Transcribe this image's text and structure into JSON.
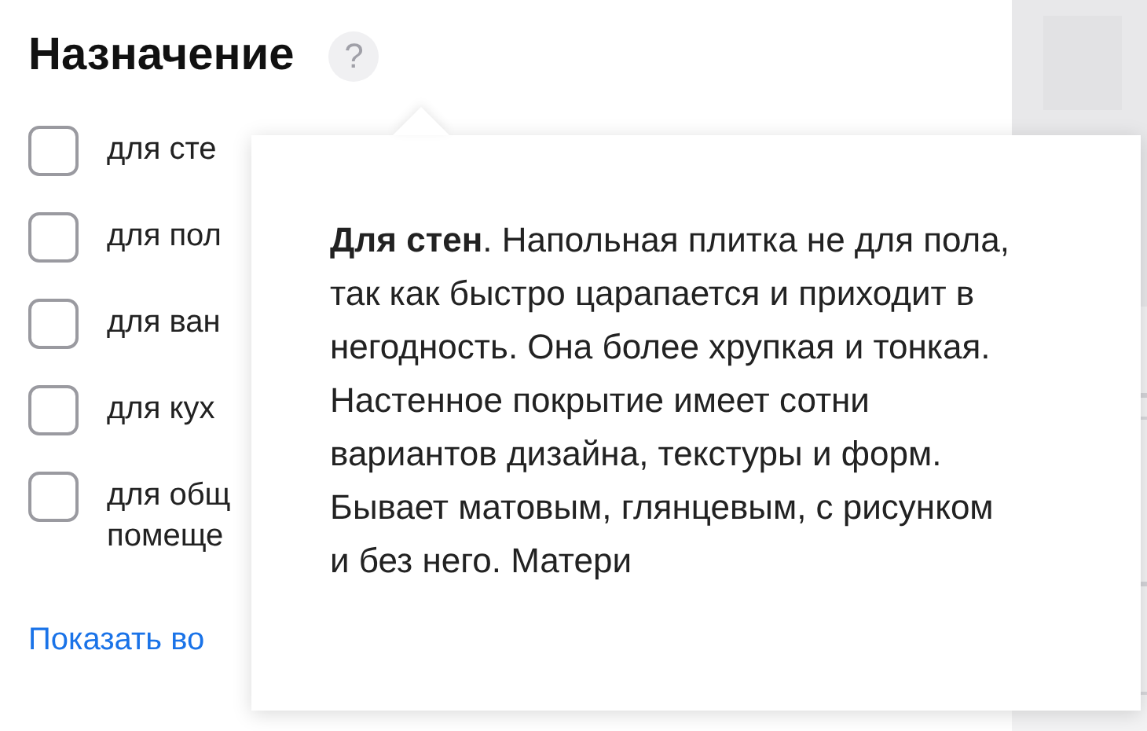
{
  "filter": {
    "title": "Назначение",
    "help": "?",
    "options": [
      {
        "label": "для сте",
        "checked": false
      },
      {
        "label": "для пол",
        "checked": false
      },
      {
        "label": "для ван",
        "checked": false
      },
      {
        "label": "для кух",
        "checked": false
      },
      {
        "label": "для общ\nпомеще",
        "checked": false
      }
    ],
    "show_all_link": "Показать во"
  },
  "tooltip": {
    "text": "**Для стен**. Напольная плитка не для пола, так как быстро царапается и приходит в негодность. Она более хрупкая и тонкая. Настенное покрытие имеет сотни вариантов дизайна, текстуры и форм. Бывает матовым, глянцевым, с рисунком и без него. Матери"
  }
}
